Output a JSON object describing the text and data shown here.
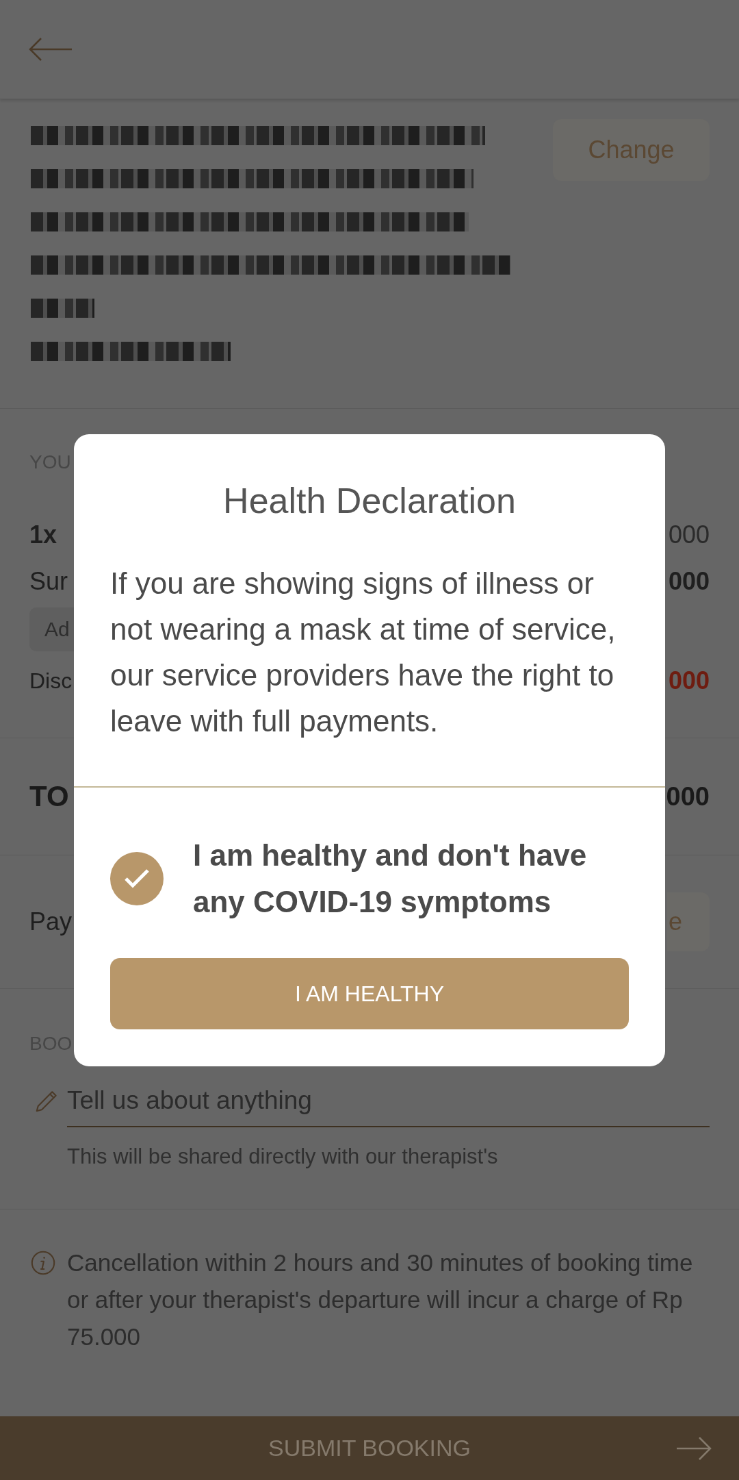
{
  "address": {
    "change_button": "Change"
  },
  "order": {
    "section_label": "YOU",
    "rows": [
      {
        "kind": "item",
        "label": "1x",
        "value": "000"
      },
      {
        "kind": "fee",
        "label": "Sur",
        "value": "000"
      },
      {
        "kind": "chip",
        "label": "Ad"
      },
      {
        "kind": "discount",
        "label": "Disc",
        "value": "000"
      }
    ]
  },
  "total": {
    "label": "TO",
    "value": "000"
  },
  "payment": {
    "label": "Pay",
    "button": "e"
  },
  "booking_notes": {
    "section_label": "BOO",
    "placeholder": "Tell us about anything",
    "helper": "This will be shared directly with our therapist's"
  },
  "cancellation_notice": "Cancellation within 2 hours and 30 minutes of booking time or after your therapist's departure will incur a charge of Rp 75.000",
  "submit_button": "SUBMIT BOOKING",
  "dialog": {
    "title": "Health Declaration",
    "message": "If you are showing signs of illness or not wearing a mask at time of service, our service providers have the right to leave with full payments.",
    "checkbox": {
      "label": "I am healthy and don't have any COVID-19 symptoms",
      "checked": true
    },
    "button": "I AM HEALTHY"
  }
}
